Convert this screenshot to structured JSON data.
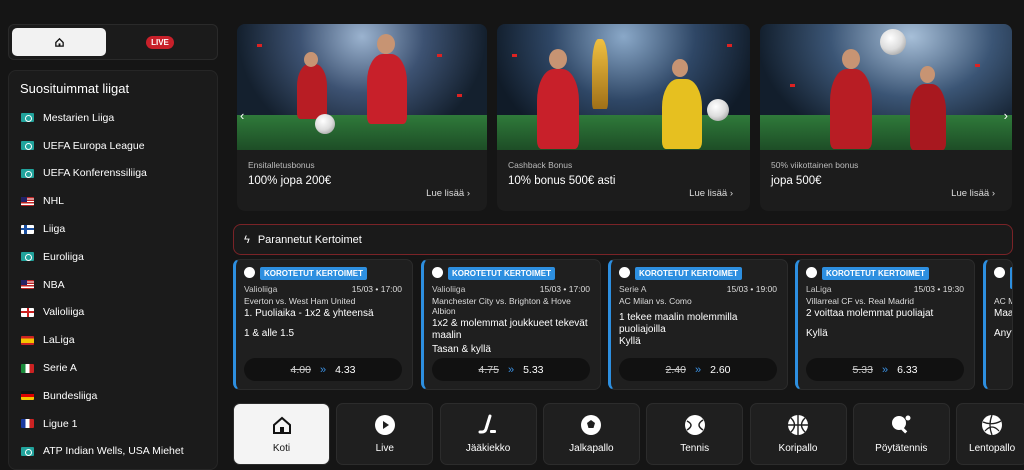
{
  "topbar": {
    "live_label": "LIVE"
  },
  "sidebar": {
    "heading": "Suosituimmat liigat",
    "items": [
      {
        "label": "Mestarien Liiga",
        "flag": "intl"
      },
      {
        "label": "UEFA Europa League",
        "flag": "intl"
      },
      {
        "label": "UEFA Konferenssiliiga",
        "flag": "intl"
      },
      {
        "label": "NHL",
        "flag": "us"
      },
      {
        "label": "Liiga",
        "flag": "fi"
      },
      {
        "label": "Euroliiga",
        "flag": "intl"
      },
      {
        "label": "NBA",
        "flag": "us"
      },
      {
        "label": "Valioliiga",
        "flag": "en"
      },
      {
        "label": "LaLiga",
        "flag": "es"
      },
      {
        "label": "Serie A",
        "flag": "it"
      },
      {
        "label": "Bundesliiga",
        "flag": "de"
      },
      {
        "label": "Ligue 1",
        "flag": "fr"
      },
      {
        "label": "ATP Indian Wells, USA Miehet",
        "flag": "intl"
      }
    ]
  },
  "promos": [
    {
      "tag": "Ensitalletusbonus",
      "title": "100% jopa 200€",
      "more": "Lue lisää"
    },
    {
      "tag": "Cashback Bonus",
      "title": "10% bonus 500€ asti",
      "more": "Lue lisää"
    },
    {
      "tag": "50% viikottainen bonus",
      "title": "jopa 500€",
      "more": "Lue lisää"
    }
  ],
  "boosted": {
    "heading": "Parannetut Kertoimet"
  },
  "odds": [
    {
      "badge": "KOROTETUT KERTOIMET",
      "league": "Valioliiga",
      "date": "15/03 • 17:00",
      "match": "Everton vs. West Ham United",
      "market": "1. Puoliaika - 1x2 & yhteensä",
      "pick": "1 & alle 1.5",
      "old": "4.00",
      "new": "4.33"
    },
    {
      "badge": "KOROTETUT KERTOIMET",
      "league": "Valioliiga",
      "date": "15/03 • 17:00",
      "match": "Manchester City vs. Brighton & Hove Albion",
      "market": "1x2 & molemmat joukkueet tekevät maalin",
      "pick": "Tasan & kyllä",
      "old": "4.75",
      "new": "5.33"
    },
    {
      "badge": "KOROTETUT KERTOIMET",
      "league": "Serie A",
      "date": "15/03 • 19:00",
      "match": "AC Milan vs. Como",
      "market": "1 tekee maalin molemmilla puoliajoilla",
      "pick": "Kyllä",
      "old": "2.40",
      "new": "2.60"
    },
    {
      "badge": "KOROTETUT KERTOIMET",
      "league": "LaLiga",
      "date": "15/03 • 19:30",
      "match": "Villarreal CF vs. Real Madrid",
      "market": "2 voittaa molemmat puoliajat",
      "pick": "Kyllä",
      "old": "5.33",
      "new": "6.33"
    },
    {
      "badge": "KOROTETUT KERTOIMET",
      "league": "",
      "date": "",
      "match": "AC M",
      "market": "Maal",
      "pick": "Anyt",
      "old": "",
      "new": ""
    }
  ],
  "sports": [
    {
      "label": "Koti",
      "icon": "home-icon"
    },
    {
      "label": "Live",
      "icon": "play-icon"
    },
    {
      "label": "Jääkiekko",
      "icon": "hockey-icon"
    },
    {
      "label": "Jalkapallo",
      "icon": "soccer-icon"
    },
    {
      "label": "Tennis",
      "icon": "tennis-icon"
    },
    {
      "label": "Koripallo",
      "icon": "basketball-icon"
    },
    {
      "label": "Pöytätennis",
      "icon": "table-tennis-icon"
    },
    {
      "label": "Lentopallo",
      "icon": "volleyball-icon"
    }
  ],
  "colors": {
    "accent": "#2d8fe0",
    "live": "#c8202a",
    "border_red": "#7a2327"
  }
}
